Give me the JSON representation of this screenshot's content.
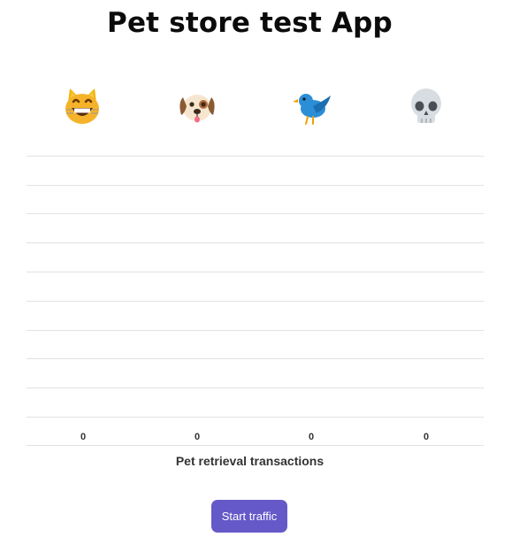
{
  "app": {
    "title": "Pet store test App"
  },
  "pets": [
    {
      "name": "cat",
      "icon": "grinning-cat-face-icon"
    },
    {
      "name": "dog",
      "icon": "dog-face-icon"
    },
    {
      "name": "bird",
      "icon": "bird-icon"
    },
    {
      "name": "skull",
      "icon": "skull-icon"
    }
  ],
  "chart_data": {
    "type": "bar",
    "categories": [
      "cat",
      "dog",
      "bird",
      "skull"
    ],
    "values": [
      0,
      0,
      0
    ],
    "value_labels": [
      "0",
      "0",
      "0",
      "0"
    ],
    "xlabel": "Pet retrieval transactions",
    "ylabel": "",
    "grid": true
  },
  "actions": {
    "start_label": "Start traffic"
  },
  "colors": {
    "button": "#6558c9",
    "grid": "#e2e2e2"
  }
}
